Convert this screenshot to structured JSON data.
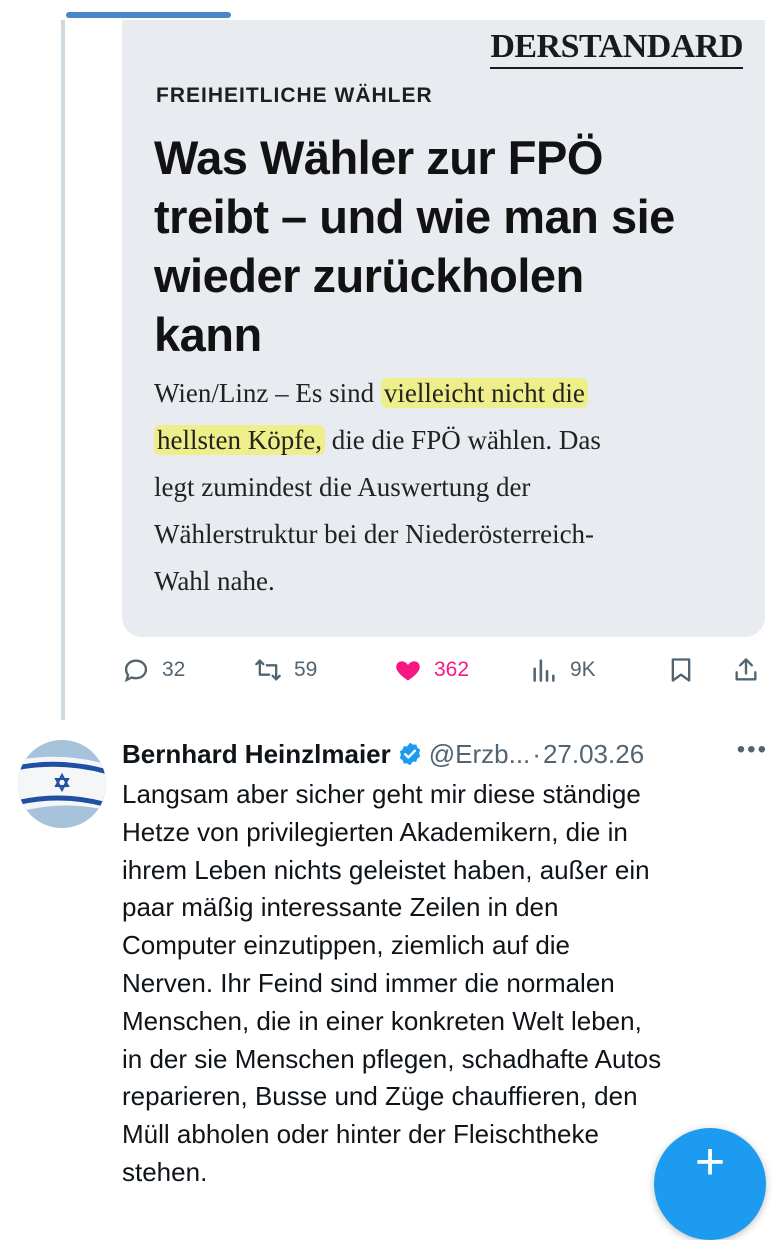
{
  "quoted_media": {
    "publisher": "DERSTANDARD",
    "kicker": "FREIHEITLICHE WÄHLER",
    "headline_lines": [
      "Was Wähler zur FPÖ",
      "treibt – und wie man sie",
      "wieder zurückholen",
      "kann"
    ],
    "lede": {
      "l1_pre": "Wien/Linz – Es sind ",
      "l1_hl": "vielleicht nicht die",
      "l2_hl": "hellsten Köpfe,",
      "l2_post": " die die FPÖ wählen. Das",
      "l3": "legt zumindest die Auswertung der",
      "l4": "Wählerstruktur bei der Niederösterreich-",
      "l5": "Wahl nahe."
    },
    "highlight_color": "#eef078"
  },
  "actions": {
    "replies": "32",
    "retweets": "59",
    "likes": "362",
    "views": "9K",
    "like_color": "#f91880"
  },
  "reply": {
    "author": "Bernhard Heinzlmaier",
    "handle": "@Erzb...",
    "separator": "·",
    "date": "27.03.26",
    "more": "•••",
    "lines": [
      "Langsam aber sicher geht mir diese ständige",
      "Hetze von privilegierten Akademikern, die in",
      "ihrem Leben nichts geleistet haben, außer ein",
      "paar  mäßig interessante Zeilen in den",
      "Computer einzutippen, ziemlich auf die",
      "Nerven. Ihr Feind sind immer die normalen",
      "Menschen, die in einer konkreten Welt leben,",
      "in der sie Menschen pflegen, schadhafte Autos",
      "reparieren, Busse und Züge chauffieren, den",
      "Müll abholen oder hinter der Fleischtheke",
      "stehen."
    ]
  },
  "fab": {
    "label": "+",
    "color": "#1d9bf0"
  },
  "icons": [
    "reply-icon",
    "retweet-icon",
    "heart-icon",
    "views-icon",
    "bookmark-icon",
    "share-icon",
    "verified-badge-icon",
    "israel-flag-avatar",
    "compose-plus-icon"
  ]
}
